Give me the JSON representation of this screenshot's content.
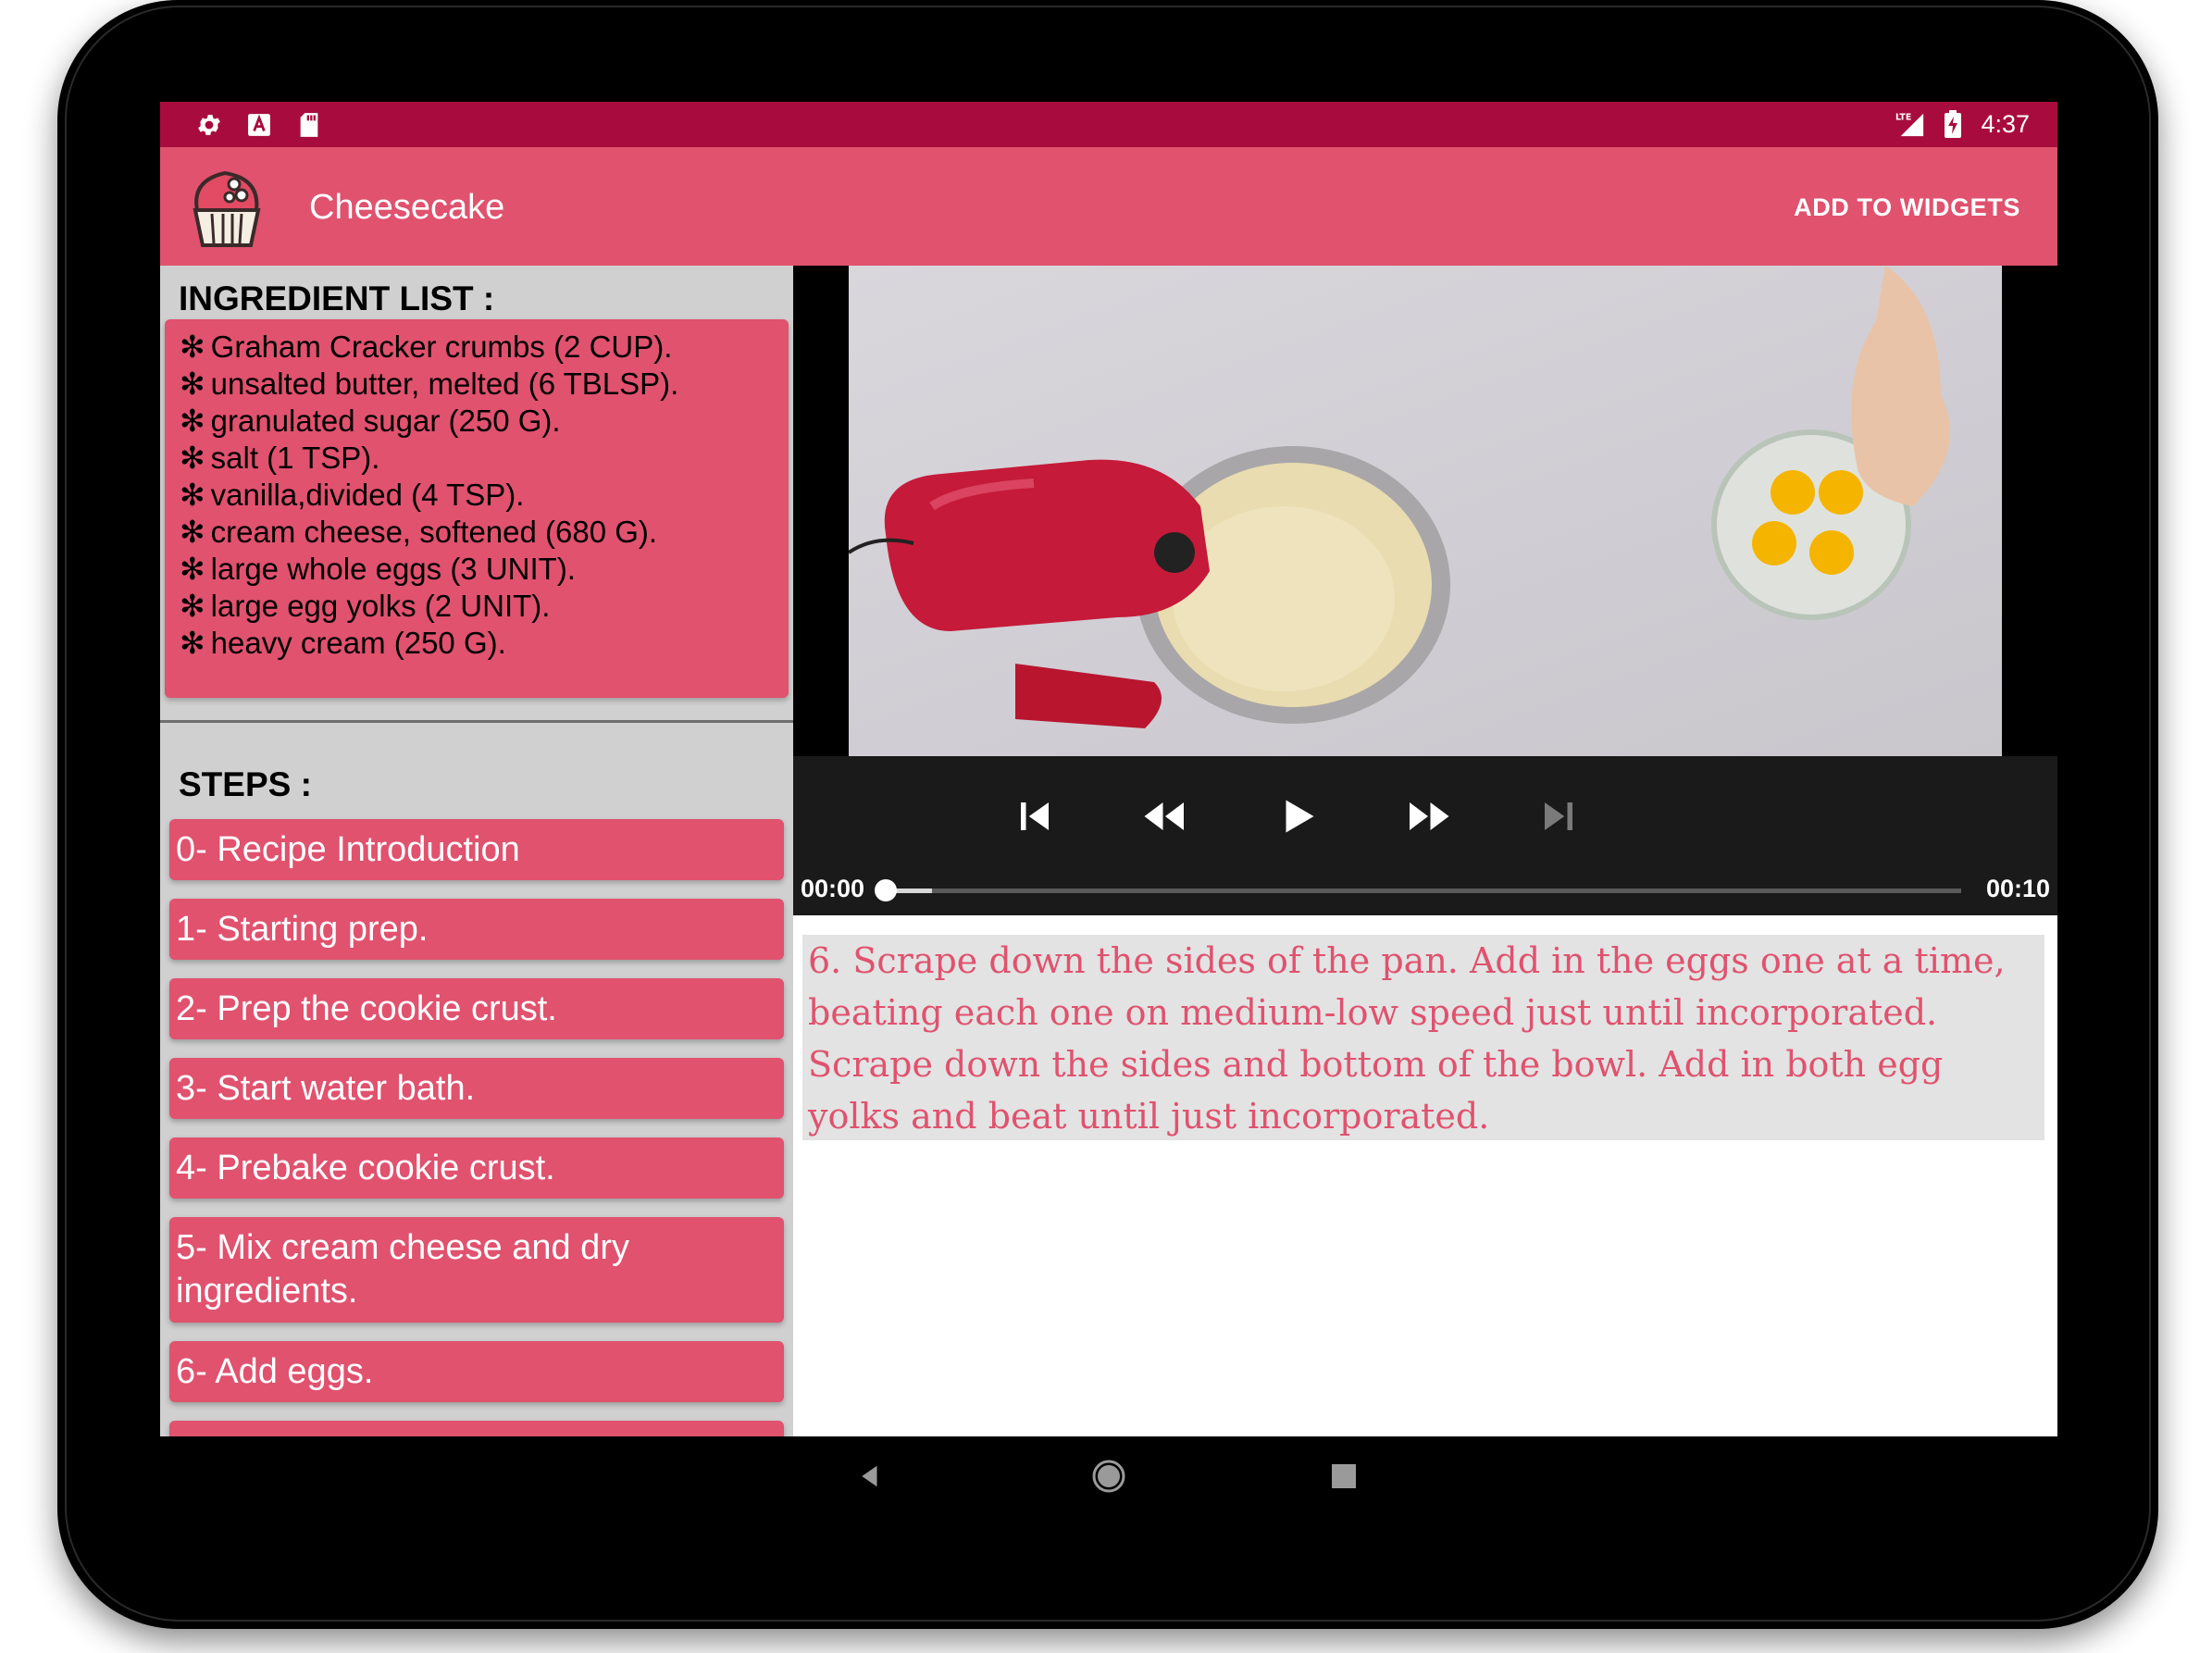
{
  "status_bar": {
    "left_icons": [
      "settings-icon",
      "a-square-icon",
      "sd-card-icon"
    ],
    "network": "LTE",
    "time": "4:37"
  },
  "app_bar": {
    "title": "Cheesecake",
    "action_label": "ADD TO WIDGETS",
    "logo": "cupcake-icon"
  },
  "ingredients": {
    "title": "INGREDIENT LIST :",
    "bullet": "✻",
    "items": [
      "Graham Cracker crumbs (2 CUP).",
      "unsalted butter, melted (6 TBLSP).",
      "granulated sugar (250 G).",
      "salt (1 TSP).",
      "vanilla,divided (4 TSP).",
      "cream cheese, softened (680 G).",
      "large whole eggs (3 UNIT).",
      "large egg yolks (2 UNIT).",
      "heavy cream (250 G)."
    ]
  },
  "steps": {
    "title": "STEPS :",
    "items": [
      "0- Recipe Introduction",
      "1- Starting prep.",
      "2- Prep the cookie crust.",
      "3- Start water bath.",
      "4- Prebake cookie crust.",
      "5- Mix cream cheese and dry ingredients.",
      "6- Add eggs.",
      ""
    ]
  },
  "player": {
    "position": "00:00",
    "duration": "00:10",
    "progress": 0.0,
    "buffered": 0.045,
    "controls": [
      "skip-previous-icon",
      "rewind-icon",
      "play-icon",
      "fast-forward-icon",
      "skip-next-icon"
    ],
    "skip_next_enabled": false
  },
  "description": {
    "text": "6. Scrape down the sides of the pan. Add in the eggs one at a time, beating each one on medium-low speed just until incorporated. Scrape down the sides and bottom of the bowl. Add in both egg yolks and beat until just incorporated."
  },
  "nav_bar": {
    "buttons": [
      "back-icon",
      "home-icon",
      "recents-icon"
    ]
  },
  "colors": {
    "status_bar": "#a80c3e",
    "primary": "#e0526e",
    "panel_bg": "#d0d0d0",
    "description_bg": "#e3e3e3"
  }
}
